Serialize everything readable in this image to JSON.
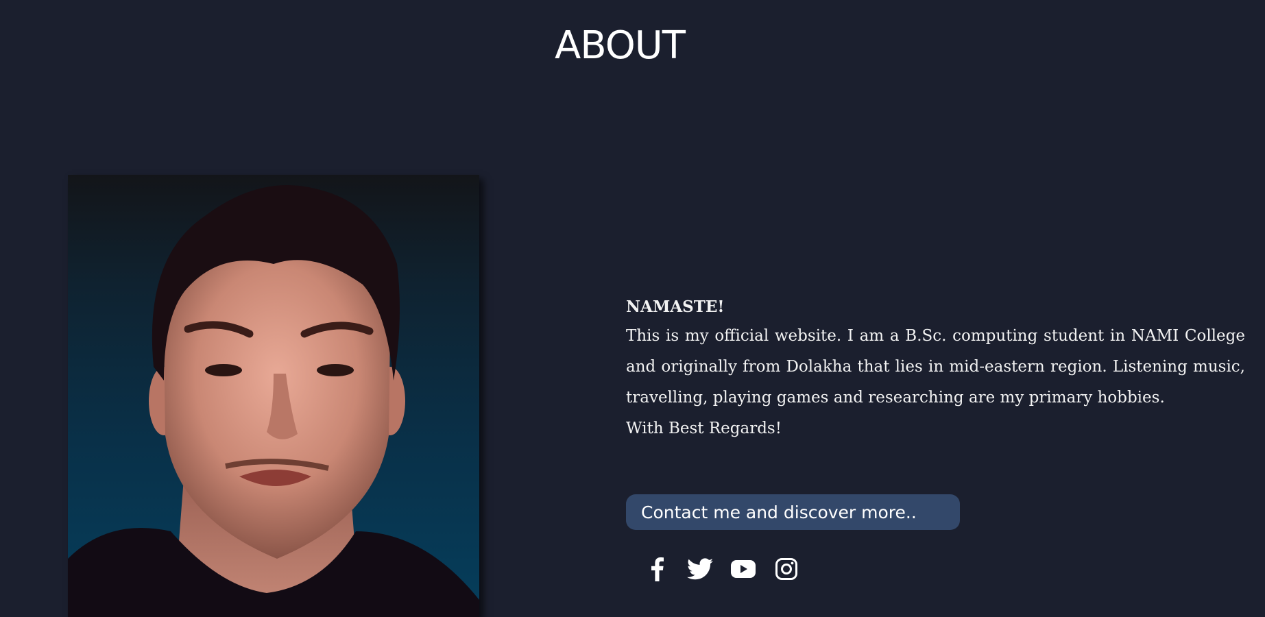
{
  "header": {
    "title": "ABOUT"
  },
  "profile": {
    "photo": "profile-photo"
  },
  "about": {
    "greeting": "NAMASTE!",
    "bio": "This is my official website. I am a B.Sc. computing student in NAMI College and originally from Dolakha that lies in mid-eastern region. Listening music, travelling, playing games and researching are my primary hobbies.",
    "regards": "With Best Regards!"
  },
  "cta": {
    "label": "Contact me and discover more.."
  },
  "social": [
    {
      "name": "facebook",
      "icon": "facebook-icon"
    },
    {
      "name": "twitter",
      "icon": "twitter-icon"
    },
    {
      "name": "youtube",
      "icon": "youtube-icon"
    },
    {
      "name": "instagram",
      "icon": "instagram-icon"
    }
  ],
  "colors": {
    "background": "#1b1f2e",
    "button": "#33486a",
    "text": "#ffffff"
  }
}
